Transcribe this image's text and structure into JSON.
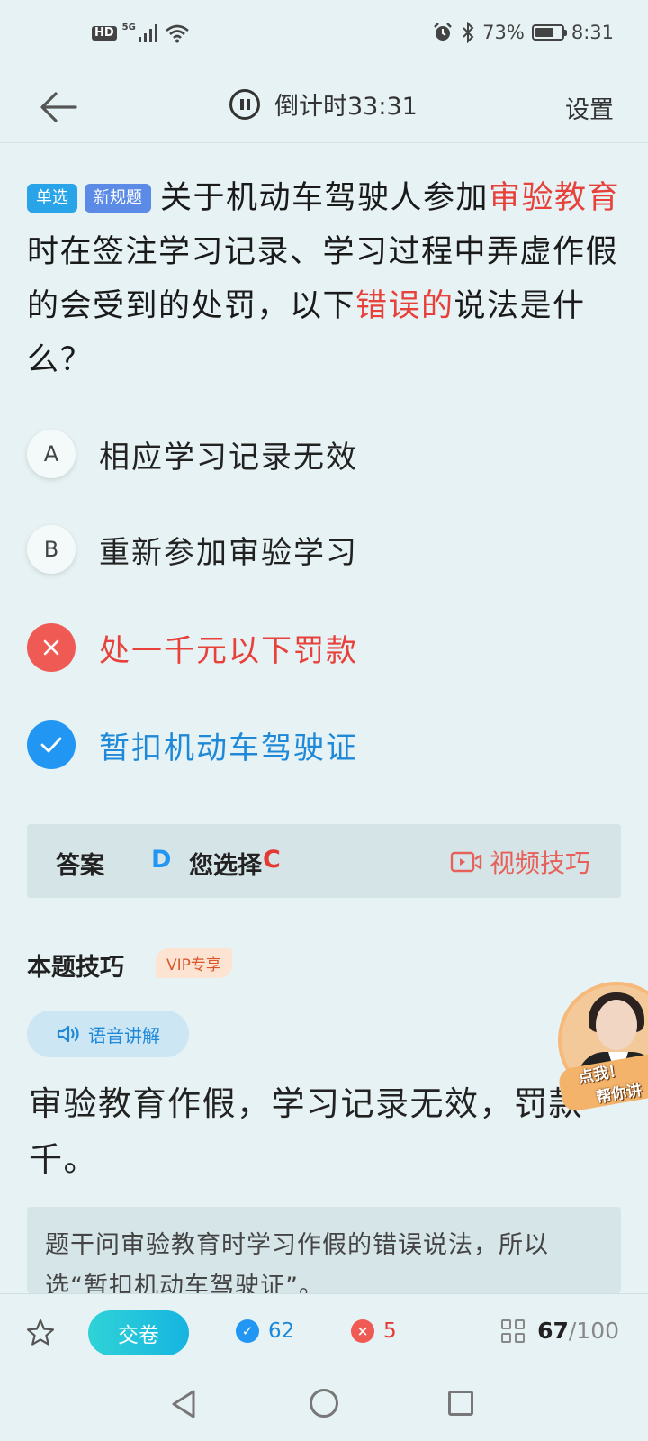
{
  "status_bar": {
    "hd_label": "HD",
    "network_label": "5G",
    "battery_percent": "73%",
    "battery_level": 0.73,
    "time": "8:31"
  },
  "nav": {
    "timer_text": "倒计时33:31",
    "settings_label": "设置"
  },
  "question": {
    "tag_type": "单选",
    "tag_new": "新规题",
    "segments": [
      {
        "text": "关于机动车驾驶人参加",
        "highlight": false
      },
      {
        "text": "审验教育",
        "highlight": true
      },
      {
        "text": "时在签注学习记录、学习过程中弄虚作假的会受到的处罚，以下",
        "highlight": false
      },
      {
        "text": "错误的",
        "highlight": true
      },
      {
        "text": "说法是什么？",
        "highlight": false
      }
    ]
  },
  "options": [
    {
      "letter": "A",
      "text": "相应学习记录无效",
      "state": "normal"
    },
    {
      "letter": "B",
      "text": "重新参加审验学习",
      "state": "normal"
    },
    {
      "letter": "×",
      "text": "处一千元以下罚款",
      "state": "wrong"
    },
    {
      "letter": "✓",
      "text": "暂扣机动车驾驶证",
      "state": "right"
    }
  ],
  "answer": {
    "answer_label": "答案",
    "answer_value": "D",
    "chosen_label": "您选择",
    "chosen_value": "C",
    "video_tip_label": "视频技巧"
  },
  "tips": {
    "title": "本题技巧",
    "vip_label": "VIP专享",
    "voice_label": "语音讲解",
    "tip_text": "审验教育作假，学习记录无效，罚款一千。",
    "explain_text": "题干问审验教育时学习作假的错误说法，所以选“暂扣机动车驾驶证”。"
  },
  "assistant": {
    "line1": "点我！",
    "line2": "帮你讲"
  },
  "bottom_bar": {
    "submit_label": "交卷",
    "right_count": "62",
    "wrong_count": "5",
    "current": "67",
    "total": "/100"
  },
  "colors": {
    "background": "#e6f2f3",
    "highlight_red": "#e8403a",
    "right_blue": "#2196f3",
    "wrong_red": "#f05a55",
    "submit_gradient_start": "#2fd3d7",
    "submit_gradient_end": "#16b4e0"
  }
}
